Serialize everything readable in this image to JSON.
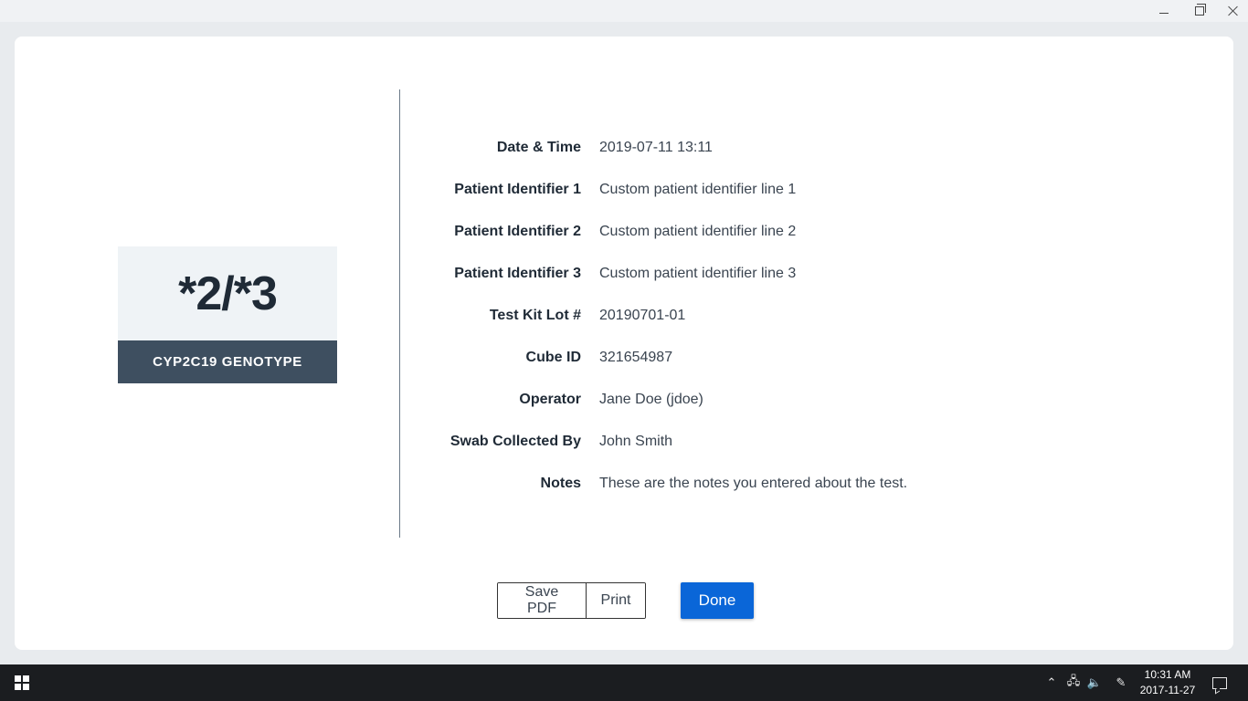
{
  "window": {
    "minimize_icon": "minimize-icon",
    "maximize_icon": "restore-icon",
    "close_icon": "close-icon"
  },
  "genotype": {
    "value": "*2/*3",
    "label": "CYP2C19 GENOTYPE"
  },
  "details": [
    {
      "label": "Date & Time",
      "value": "2019-07-11 13:11"
    },
    {
      "label": "Patient Identifier 1",
      "value": "Custom patient identifier line 1"
    },
    {
      "label": "Patient Identifier 2",
      "value": "Custom patient identifier line 2"
    },
    {
      "label": "Patient Identifier 3",
      "value": "Custom patient identifier line 3"
    },
    {
      "label": "Test Kit Lot #",
      "value": "20190701-01"
    },
    {
      "label": "Cube ID",
      "value": "321654987"
    },
    {
      "label": "Operator",
      "value": "Jane Doe (jdoe)"
    },
    {
      "label": "Swab Collected By",
      "value": "John Smith"
    },
    {
      "label": "Notes",
      "value": "These are the notes you entered about the test."
    }
  ],
  "actions": {
    "save_pdf": "Save PDF",
    "print": "Print",
    "done": "Done"
  },
  "colors": {
    "accent": "#0a66d8",
    "genotype_label_bg": "#3e4f60",
    "genotype_value_bg": "#eff3f6"
  },
  "taskbar": {
    "time": "10:31 AM",
    "date": "2017-11-27",
    "up_glyph": "⌃",
    "net_glyph": "🖧",
    "vol_glyph": "🔈",
    "pen_glyph": "✎"
  }
}
